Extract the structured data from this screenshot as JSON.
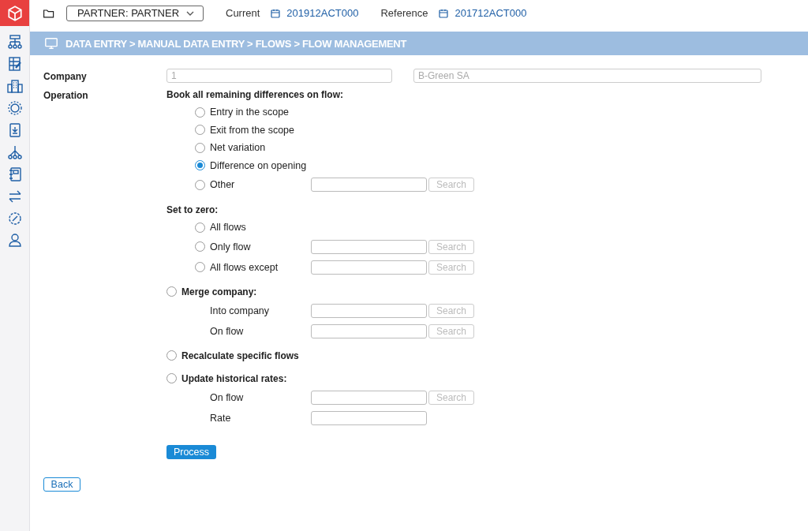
{
  "top_bar": {
    "partner_select": "PARTNER: PARTNER",
    "current_label": "Current",
    "current_value": "201912ACT000",
    "reference_label": "Reference",
    "reference_value": "201712ACT000"
  },
  "breadcrumb": "DATA ENTRY > MANUAL DATA ENTRY > FLOWS > FLOW MANAGEMENT",
  "company": {
    "label": "Company",
    "code": "1",
    "name": "B-Green SA",
    "disabled": true
  },
  "operation": {
    "label": "Operation",
    "rows": [
      {
        "kind": "heading",
        "label": "Book all remaining differences on flow:"
      },
      {
        "kind": "option",
        "label": "Entry in the scope",
        "selected": false
      },
      {
        "kind": "option",
        "label": "Exit from the scope",
        "selected": false
      },
      {
        "kind": "option",
        "label": "Net variation",
        "selected": false
      },
      {
        "kind": "option",
        "label": "Difference on opening",
        "selected": true
      },
      {
        "kind": "option",
        "label": "Other",
        "selected": false,
        "field": {
          "kind": "search",
          "button": "Search"
        }
      },
      {
        "kind": "heading",
        "label": "Set to zero:"
      },
      {
        "kind": "option",
        "label": "All flows",
        "selected": false
      },
      {
        "kind": "option",
        "label": "Only flow",
        "selected": false,
        "field": {
          "kind": "search",
          "button": "Search"
        }
      },
      {
        "kind": "option",
        "label": "All flows except",
        "selected": false,
        "field": {
          "kind": "search",
          "button": "Search"
        }
      },
      {
        "kind": "top-option",
        "label": "Merge company:",
        "selected": false
      },
      {
        "kind": "subfield",
        "label": "Into company",
        "field": {
          "kind": "search",
          "button": "Search"
        }
      },
      {
        "kind": "subfield",
        "label": "On flow",
        "field": {
          "kind": "search",
          "button": "Search"
        }
      },
      {
        "kind": "top-option",
        "label": "Recalculate specific flows",
        "selected": false
      },
      {
        "kind": "top-option",
        "label": "Update historical rates:",
        "selected": false
      },
      {
        "kind": "subfield",
        "label": "On flow",
        "field": {
          "kind": "search",
          "button": "Search"
        }
      },
      {
        "kind": "subfield",
        "label": "Rate",
        "field": {
          "kind": "plain"
        }
      }
    ],
    "process": "Process"
  },
  "back": "Back"
}
